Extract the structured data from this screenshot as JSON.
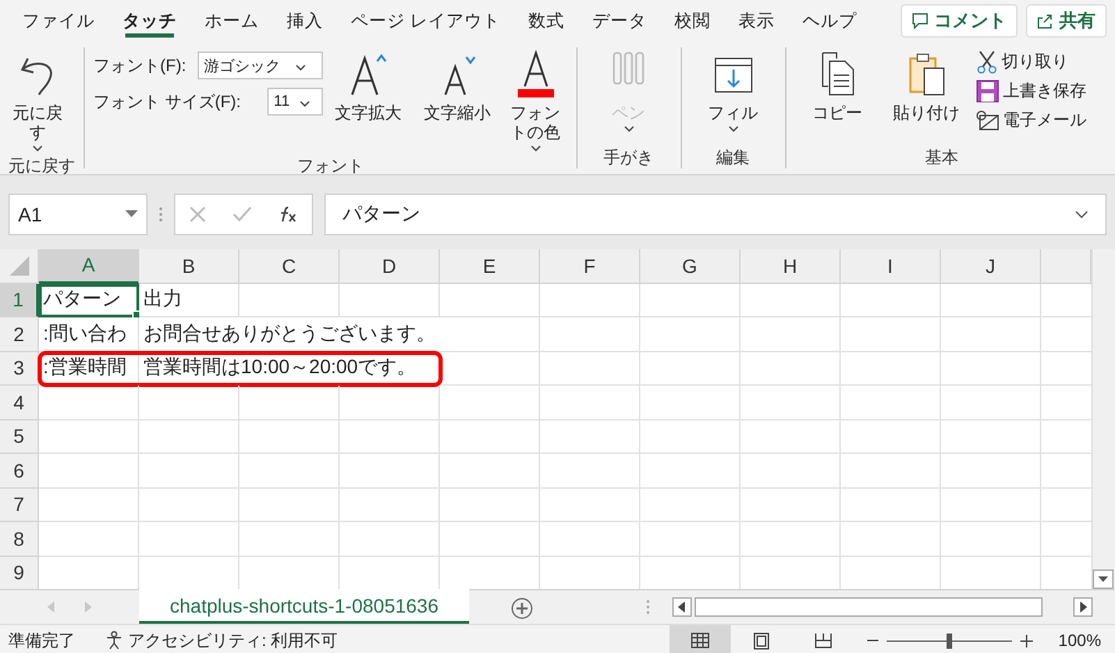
{
  "tabs": [
    {
      "label": "ファイル",
      "selected": false
    },
    {
      "label": "タッチ",
      "selected": true
    },
    {
      "label": "ホーム",
      "selected": false
    },
    {
      "label": "挿入",
      "selected": false
    },
    {
      "label": "ページ レイアウト",
      "selected": false
    },
    {
      "label": "数式",
      "selected": false
    },
    {
      "label": "データ",
      "selected": false
    },
    {
      "label": "校閲",
      "selected": false
    },
    {
      "label": "表示",
      "selected": false
    },
    {
      "label": "ヘルプ",
      "selected": false
    }
  ],
  "header_buttons": [
    "コメント",
    "共有"
  ],
  "ribbon": {
    "groups": [
      {
        "label": "元に戻す",
        "buttons": [
          {
            "label": "元に戻す",
            "has_menu": true,
            "disabled": false
          }
        ]
      },
      {
        "label": "フォント",
        "font": {
          "label": "フォント(F):",
          "value": "游ゴシック"
        },
        "size": {
          "label": "フォント サイズ(F):",
          "value": "11"
        },
        "buttons": [
          {
            "label": "文字拡大",
            "has_menu": false,
            "disabled": false
          },
          {
            "label": "文字縮小",
            "has_menu": false,
            "disabled": false
          },
          {
            "label": "フォントの色",
            "has_menu": true,
            "disabled": false
          }
        ]
      },
      {
        "label": "手がき",
        "buttons": [
          {
            "label": "ペン",
            "has_menu": true,
            "disabled": true
          }
        ]
      },
      {
        "label": "編集",
        "buttons": [
          {
            "label": "フィル",
            "has_menu": true,
            "disabled": false
          }
        ]
      },
      {
        "label": "基本",
        "buttons": [
          {
            "label": "コピー",
            "has_menu": false,
            "disabled": false
          },
          {
            "label": "貼り付け",
            "has_menu": false,
            "disabled": false
          },
          {
            "label": "切り取り",
            "has_menu": false,
            "disabled": false
          },
          {
            "label": "上書き保存",
            "has_menu": false,
            "disabled": false
          },
          {
            "label": "電子メール",
            "has_menu": false,
            "disabled": false
          }
        ]
      }
    ]
  },
  "formula_bar": {
    "name_box": "A1",
    "value": "パターン"
  },
  "sheet": {
    "columns": [
      {
        "label": "A",
        "selected": true
      },
      {
        "label": "B",
        "selected": false
      },
      {
        "label": "C",
        "selected": false
      },
      {
        "label": "D",
        "selected": false
      },
      {
        "label": "E",
        "selected": false
      },
      {
        "label": "F",
        "selected": false
      },
      {
        "label": "G",
        "selected": false
      },
      {
        "label": "H",
        "selected": false
      },
      {
        "label": "I",
        "selected": false
      },
      {
        "label": "J",
        "selected": false
      }
    ],
    "rows": [
      {
        "label": "1",
        "selected": true,
        "highlighted": false,
        "cells": [
          "パターン",
          "出力"
        ]
      },
      {
        "label": "2",
        "selected": false,
        "highlighted": false,
        "cells": [
          ":問い合わ",
          "お問合せありがとうございます。"
        ]
      },
      {
        "label": "3",
        "selected": false,
        "highlighted": true,
        "cells": [
          ":営業時間",
          "営業時間は10:00～20:00です。"
        ]
      },
      {
        "label": "4",
        "selected": false,
        "highlighted": false,
        "cells": []
      },
      {
        "label": "5",
        "selected": false,
        "highlighted": false,
        "cells": []
      },
      {
        "label": "6",
        "selected": false,
        "highlighted": false,
        "cells": []
      },
      {
        "label": "7",
        "selected": false,
        "highlighted": false,
        "cells": []
      },
      {
        "label": "8",
        "selected": false,
        "highlighted": false,
        "cells": []
      },
      {
        "label": "9",
        "selected": false,
        "highlighted": false,
        "cells": []
      }
    ]
  },
  "sheet_tabs": [
    {
      "label": "chatplus-shortcuts-1-08051636",
      "selected": true
    }
  ],
  "status_bar": {
    "ready": "準備完了",
    "accessibility": "アクセシビリティ: 利用不可",
    "zoom_slider": {
      "level": 0.5
    },
    "zoom": "100%"
  }
}
